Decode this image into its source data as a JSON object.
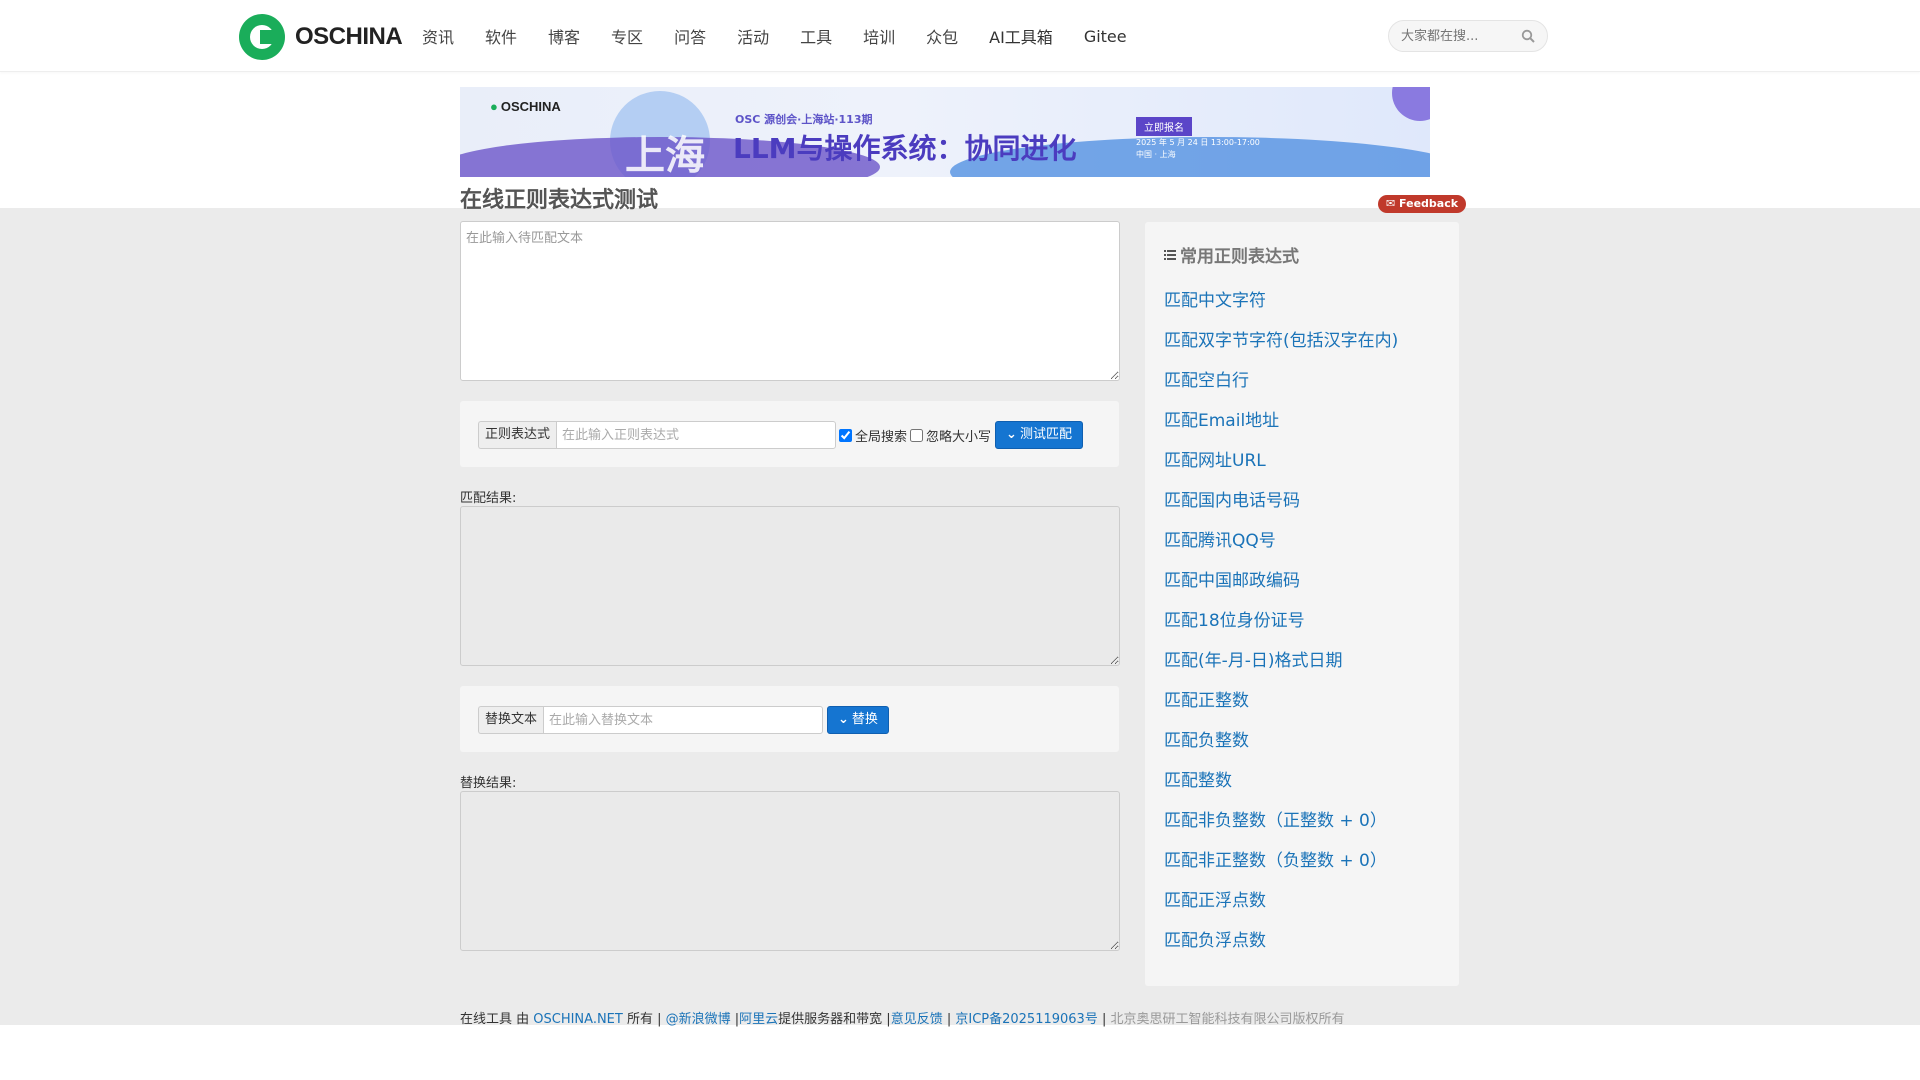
{
  "header": {
    "logo_text": "OSCHINA",
    "nav": [
      "资讯",
      "软件",
      "博客",
      "专区",
      "问答",
      "活动",
      "工具",
      "培训",
      "众包",
      "AI工具箱",
      "Gitee"
    ],
    "search_placeholder": "大家都在搜..."
  },
  "banner": {
    "logo": "OSCHINA",
    "subtitle": "OSC 源创会·上海站·113期",
    "title": "LLM与操作系统：协同进化",
    "city": "上海",
    "button": "立即报名",
    "date_line1": "2025 年 5 月 24 日 13:00-17:00",
    "date_line2": "中国 · 上海"
  },
  "page": {
    "title": "在线正则表达式测试",
    "feedback": "Feedback"
  },
  "tester": {
    "input_placeholder": "在此输入待匹配文本",
    "regex_label": "正则表达式",
    "regex_placeholder": "在此输入正则表达式",
    "global_label": "全局搜索",
    "global_checked": true,
    "ignorecase_label": "忽略大小写",
    "ignorecase_checked": false,
    "test_button": "测试匹配",
    "match_result_label": "匹配结果:",
    "replace_label": "替换文本",
    "replace_placeholder": "在此输入替换文本",
    "replace_button": "替换",
    "replace_result_label": "替换结果:"
  },
  "sidebar": {
    "title": "常用正则表达式",
    "items": [
      "匹配中文字符",
      "匹配双字节字符(包括汉字在内)",
      "匹配空白行",
      "匹配Email地址",
      "匹配网址URL",
      "匹配国内电话号码",
      "匹配腾讯QQ号",
      "匹配中国邮政编码",
      "匹配18位身份证号",
      "匹配(年-月-日)格式日期",
      "匹配正整数",
      "匹配负整数",
      "匹配整数",
      "匹配非负整数（正整数 + 0）",
      "匹配非正整数（负整数 + 0）",
      "匹配正浮点数",
      "匹配负浮点数"
    ]
  },
  "footer": {
    "prefix": "在线工具 由 ",
    "oschina": "OSCHINA.NET",
    "owned": " 所有 | ",
    "weibo": "@新浪微博",
    "sep1": " |",
    "aliyun": "阿里云",
    "aliyun_suffix": "提供服务器和带宽 |",
    "feedback": "意见反馈",
    "sep2": " | ",
    "icp": "京ICP备2025119063号",
    "sep3": " | ",
    "company": "北京奥思研工智能科技有限公司版权所有"
  }
}
